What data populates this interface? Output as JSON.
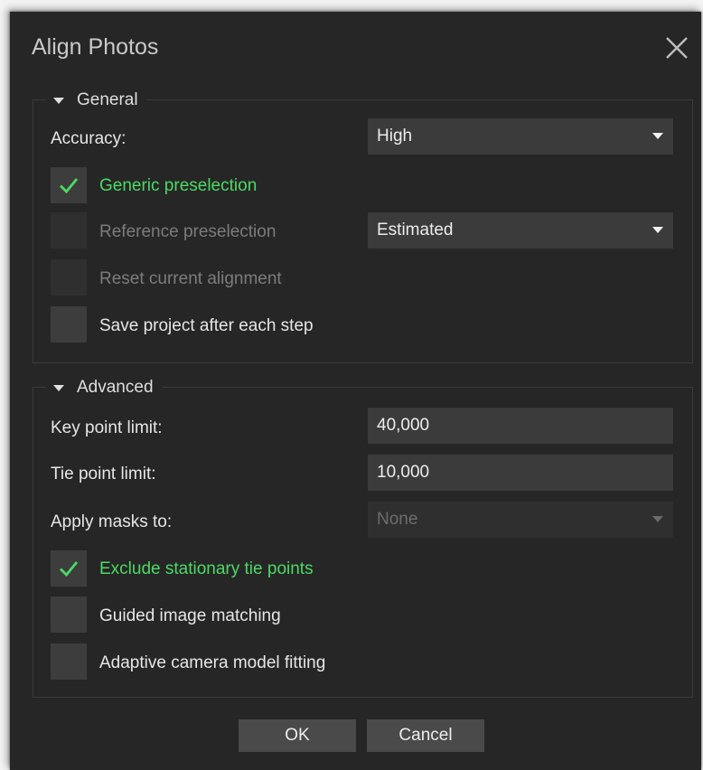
{
  "dialog": {
    "title": "Align Photos",
    "ok_label": "OK",
    "cancel_label": "Cancel"
  },
  "general": {
    "heading": "General",
    "accuracy_label": "Accuracy:",
    "accuracy_value": "High",
    "generic_preselection": {
      "label": "Generic preselection",
      "checked": true
    },
    "reference_preselection": {
      "label": "Reference preselection",
      "checked": false,
      "enabled": false,
      "mode": "Estimated"
    },
    "reset_alignment": {
      "label": "Reset current alignment",
      "checked": false,
      "enabled": false
    },
    "save_project": {
      "label": "Save project after each step",
      "checked": false
    }
  },
  "advanced": {
    "heading": "Advanced",
    "key_point_label": "Key point limit:",
    "key_point_value": "40,000",
    "tie_point_label": "Tie point limit:",
    "tie_point_value": "10,000",
    "apply_masks_label": "Apply masks to:",
    "apply_masks_value": "None",
    "exclude_stationary": {
      "label": "Exclude stationary tie points",
      "checked": true
    },
    "guided_matching": {
      "label": "Guided image matching",
      "checked": false
    },
    "adaptive_fitting": {
      "label": "Adaptive camera model fitting",
      "checked": false
    }
  },
  "colors": {
    "background": "#262626",
    "accent_green": "#4cd964",
    "control": "#3b3b3b"
  },
  "icons": {
    "close": "close-icon",
    "check": "checkmark-icon",
    "expand": "triangle-down-icon",
    "dropdown": "chevron-down-icon"
  }
}
